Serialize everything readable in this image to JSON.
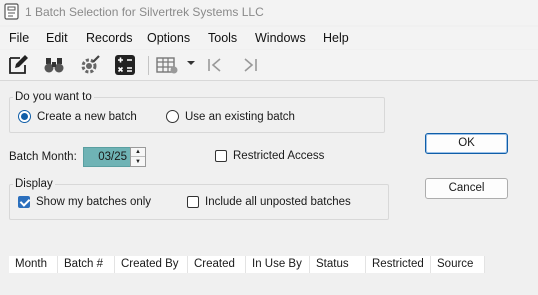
{
  "window": {
    "title": "1 Batch Selection for Silvertrek Systems LLC"
  },
  "menu": [
    "File",
    "Edit",
    "Records",
    "Options",
    "Tools",
    "Windows",
    "Help"
  ],
  "toolbar": {
    "icons": [
      "edit-icon",
      "binoculars-icon",
      "gear-icon",
      "calculator-icon",
      "grid-view-icon",
      "dropdown-arrow-icon",
      "first-record-icon",
      "last-record-icon"
    ]
  },
  "batch_choice": {
    "legend": "Do you want to",
    "options": [
      "Create a new batch",
      "Use an existing batch"
    ],
    "selected": "Create a new batch"
  },
  "batch_month": {
    "label": "Batch Month:",
    "value": "03/25"
  },
  "restricted_access": {
    "label": "Restricted Access",
    "checked": false
  },
  "display": {
    "legend": "Display",
    "show_my_batches": {
      "label": "Show my batches only",
      "checked": true
    },
    "include_unposted": {
      "label": "Include all unposted batches",
      "checked": false
    }
  },
  "buttons": {
    "ok": "OK",
    "cancel": "Cancel"
  },
  "grid": {
    "columns": [
      "Month",
      "Batch #",
      "Created By",
      "Created",
      "In Use By",
      "Status",
      "Restricted",
      "Source"
    ]
  },
  "colors": {
    "month_field": "#6fb3b5",
    "accent": "#0f5ea8",
    "checkbox_on": "#2b6fbd"
  }
}
